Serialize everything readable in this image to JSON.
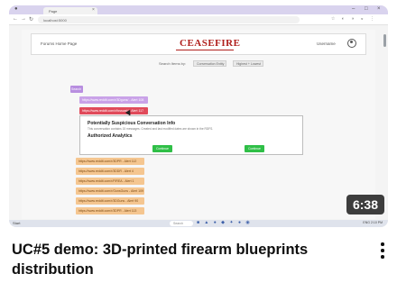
{
  "video": {
    "title": "UC#5 demo: 3D-printed firearm blueprints distribution",
    "duration": "6:38"
  },
  "browser": {
    "tab_label": "Page",
    "url": "localhost:5000",
    "window_controls": [
      "–",
      "□",
      "×"
    ],
    "nav_icons": [
      "back-icon",
      "forward-icon",
      "reload-icon"
    ]
  },
  "page": {
    "header_left": "Forums Home Page",
    "brand": "CEASEFIRE",
    "header_user": "Username",
    "filter_label": "Search Items by:",
    "filter_select_1": "Conversation Entity",
    "filter_select_2": "Highest + Lowest",
    "badge": "Search",
    "rows_top": [
      {
        "text": "https://www.reddit.com/r/3Dguns/ - Alert 108",
        "kind": "purple"
      },
      {
        "text": "https://www.reddit.com/r/fosscad/ - Alert 117",
        "kind": "red"
      }
    ],
    "panel": {
      "title": "Potentially Suspicious Conversation Info",
      "subtitle": "This conversation contains 15 messages. Created and last modified dates are shown in the RDFS.",
      "heading": "Authorized Analytics",
      "buttons": [
        "Continue",
        "Continue"
      ]
    },
    "rows_bottom": [
      "https://www.reddit.com/r/3DPR - Alert 112",
      "https://www.reddit.com/r/3DDR - Alert 4",
      "https://www.reddit.com/r/FIREA - Alert 1",
      "https://www.reddit.com/r/GunsGuns - Alert 109",
      "https://www.reddit.com/r/3DGuns - Alert 90",
      "https://www.reddit.com/r/3DPR - Alert 113"
    ]
  },
  "taskbar": {
    "left": "Start",
    "search": "Search",
    "tray": "ENG 2:10 PM"
  },
  "colors": {
    "brand": "#b0201d",
    "purple": "#c9a2e8",
    "red": "#e04a5a",
    "orange": "#f5c690",
    "green": "#2fbf47"
  }
}
